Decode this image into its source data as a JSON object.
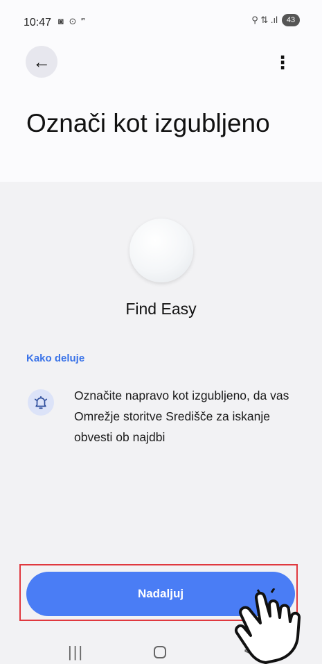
{
  "status_bar": {
    "time": "10:47",
    "left_icons": "◙ ⊙ ‴",
    "right_icons": "⚲ ⇅ .ıl",
    "battery": "43"
  },
  "header": {
    "back_icon": "arrow-left-icon",
    "back_glyph": "←",
    "more_icon": "more-vertical-icon",
    "more_glyph": "⋮"
  },
  "page": {
    "title": "Označi kot izgubljeno"
  },
  "device": {
    "name": "Find Easy"
  },
  "how_it_works": {
    "header": "Kako deluje",
    "icon": "bell-alert-icon",
    "text": "Označite napravo kot izgubljeno, da vas Omrežje storitve Središče za iskanje obvesti ob najdbi"
  },
  "actions": {
    "continue_label": "Nadaljuj"
  },
  "nav": {
    "recent_glyph": "|||",
    "back_glyph": "<"
  },
  "colors": {
    "accent": "#4a7df5",
    "link": "#3a73e8",
    "highlight": "#e0383e"
  }
}
